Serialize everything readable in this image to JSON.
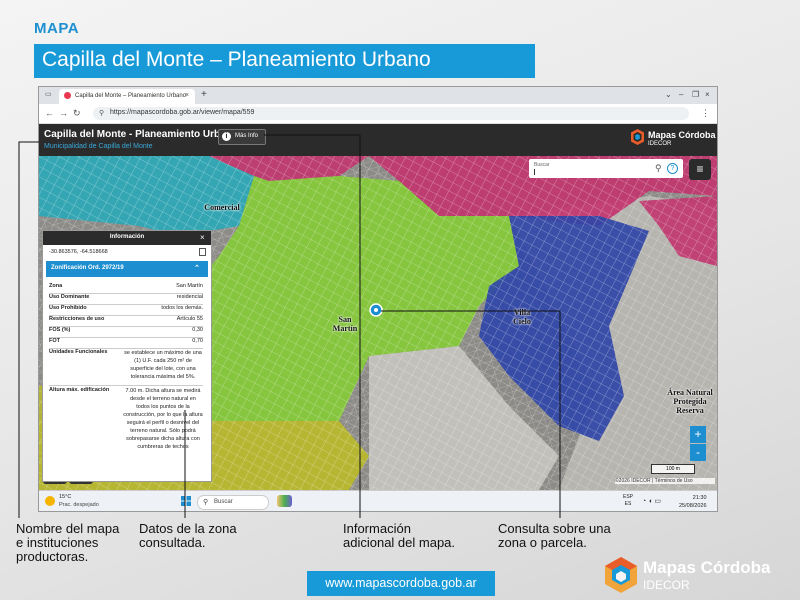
{
  "section_label": "MAPA",
  "title_banner": "Capilla del Monte – Planeamiento Urbano",
  "browser": {
    "tab_title": "Capilla del Monte – Planeamiento Urbano",
    "tab_close": "×",
    "new_tab": "+",
    "window_controls": {
      "dropdown": "⌄",
      "minimize": "–",
      "restore": "❐",
      "close": "×"
    },
    "url": "https://mapascordoba.gob.ar/viewer/mapa/559"
  },
  "app": {
    "title": "Capilla del Monte - Planeamiento Urbano",
    "subtitle": "Municipalidad de Capilla del Monte",
    "info_button": "Más Info",
    "logo_text": "Mapas Córdoba",
    "logo_sub": "IDECOR"
  },
  "search": {
    "placeholder": "Buscar",
    "help": "?"
  },
  "map_labels": {
    "comercial": "Comercial",
    "san_martin": "San Martín",
    "villa_cielo": "Villa Cielo",
    "reserva": "Área Natural Protegida Reserva"
  },
  "map_controls": {
    "zoom_in": "+",
    "zoom_out": "-",
    "scale": "100 m",
    "attribution": "©2026 IDECOR | Términos de Uso"
  },
  "info_panel": {
    "title": "Información",
    "close": "×",
    "coords": "-30.863576, -64.518668",
    "zone_title": "Zonificación Ord. 2972/19",
    "rows": [
      {
        "key": "Zona",
        "value": "San Martín"
      },
      {
        "key": "Uso Dominante",
        "value": "residencial"
      },
      {
        "key": "Uso Prohibido",
        "value": "todos los demás."
      },
      {
        "key": "Restricciones de uso",
        "value": "Artículo 55"
      },
      {
        "key": "FOS (%)",
        "value": "0,30"
      },
      {
        "key": "FOT",
        "value": "0,70"
      },
      {
        "key": "Unidades Funcionales",
        "value": "se establece un máximo de una (1) U.F. cada 250 m² de superficie del lote, con una tolerancia máxima del 5%."
      },
      {
        "key": "Altura máx. edificación",
        "value": "7.00 m. Dicha altura se medirá desde el terreno natural en todos los puntos de la construcción, por lo que la altura seguirá el perfil o desnivel del terreno natural. Sólo podrá sobrepasarse dicha altura con cumbreras de techos"
      }
    ]
  },
  "taskbar": {
    "temperature": "15°C",
    "weather": "Prac. despejado",
    "search": "Buscar",
    "lang_line1": "ESP",
    "lang_line2": "ES",
    "time": "21:30",
    "date": "25/08/2026"
  },
  "callouts": {
    "map_name": "Nombre del mapa\ne instituciones\nproductoras.",
    "zone_data": "Datos de la zona\nconsultada.",
    "more_info": "Información\nadicional del mapa.",
    "query": "Consulta sobre una\nzona o parcela."
  },
  "footer": {
    "url": "www.mapascordoba.gob.ar",
    "logo_text": "Mapas Córdoba",
    "logo_sub": "IDECOR"
  },
  "colors": {
    "accent": "#199ad8",
    "zone_green": "#86c83a",
    "zone_magenta": "#c2366f",
    "zone_blue": "#3046a8",
    "zone_teal": "#2aa8b8",
    "zone_olive": "#b8b82e"
  }
}
